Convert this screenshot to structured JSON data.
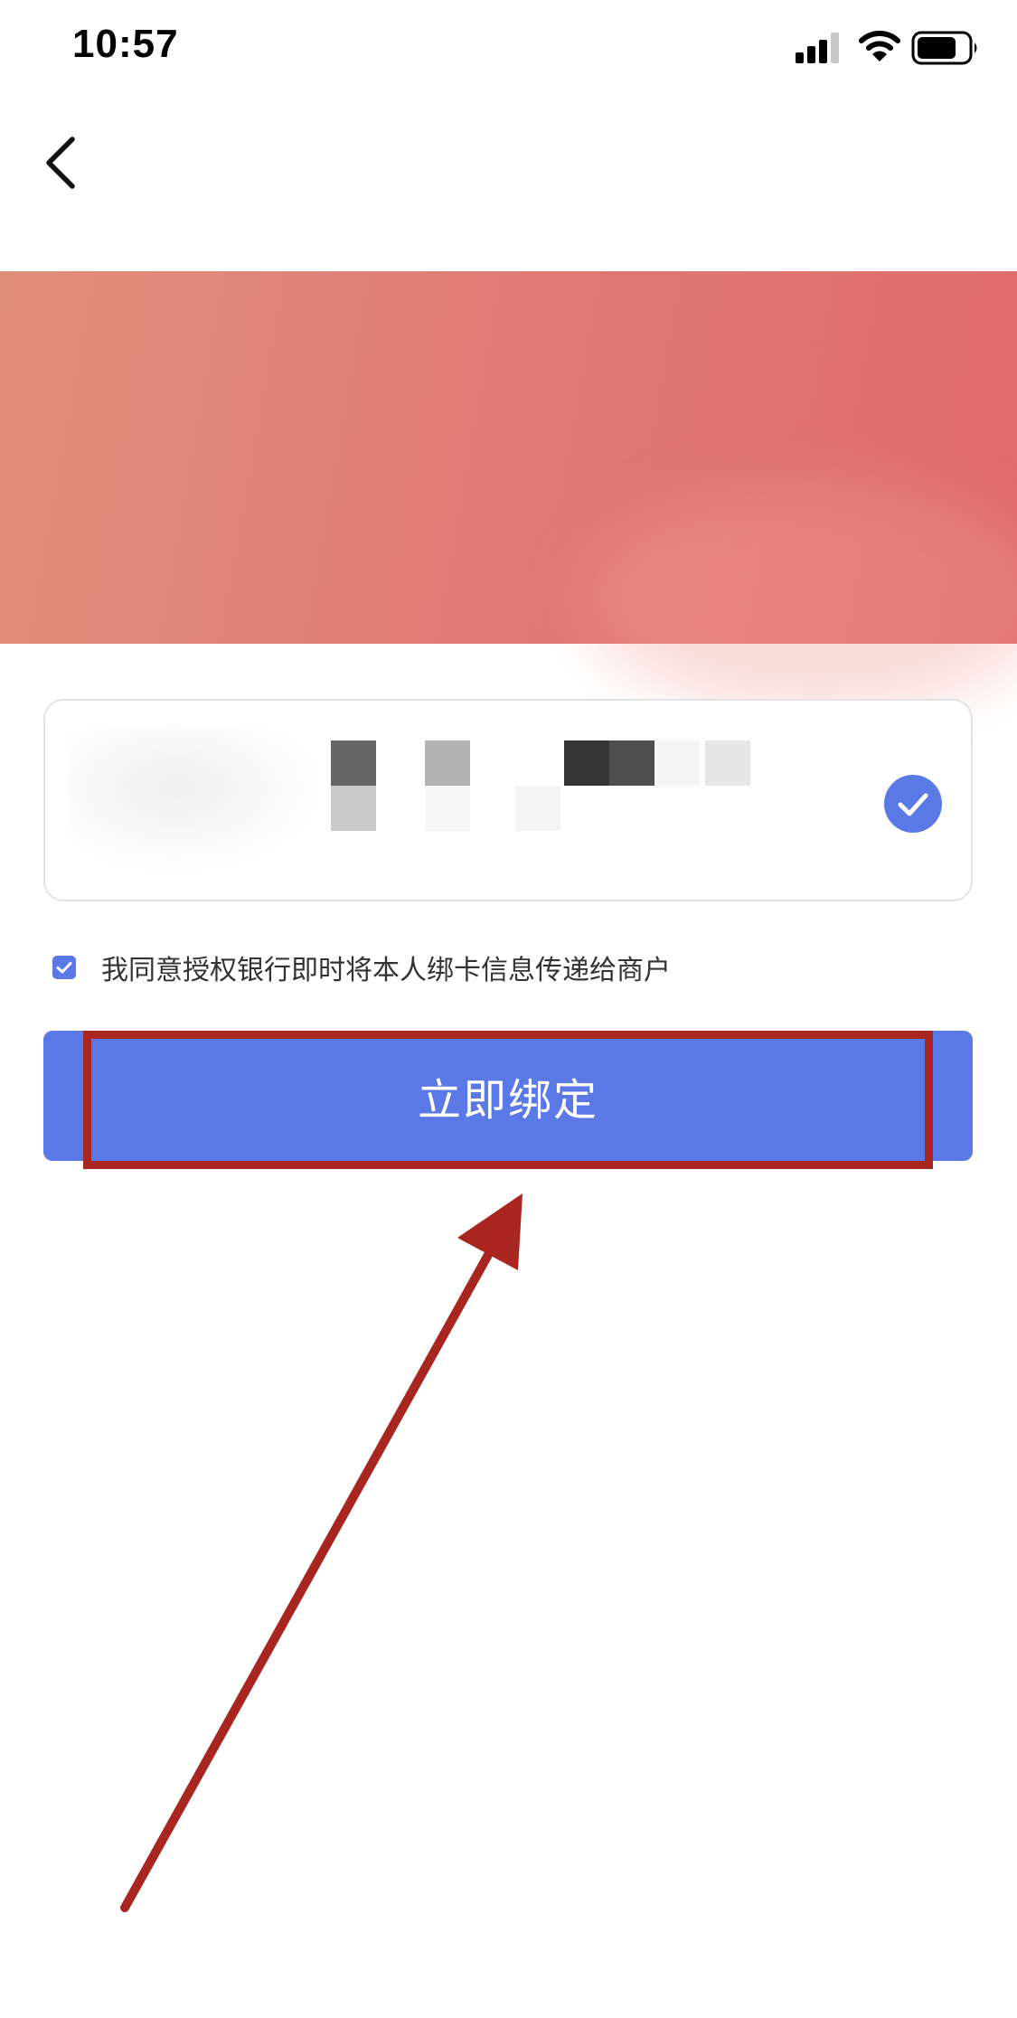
{
  "status_bar": {
    "time": "10:57"
  },
  "icons": {
    "back": "back-chevron-icon",
    "signal": "cellular-signal-icon",
    "wifi": "wifi-icon",
    "battery": "battery-icon",
    "selected": "checkmark-circle-icon",
    "agree": "checkbox-checked-icon",
    "annotation": "red-arrow-icon"
  },
  "colors": {
    "accent": "#5b79e6",
    "banner_start": "#e08f79",
    "banner_end": "#df6a6c",
    "annotation_red": "#a8261f"
  },
  "card": {
    "selected": true
  },
  "agreement": {
    "checked": true,
    "text": "我同意授权银行即时将本人绑卡信息传递给商户"
  },
  "primary_button": {
    "label": "立即绑定"
  }
}
